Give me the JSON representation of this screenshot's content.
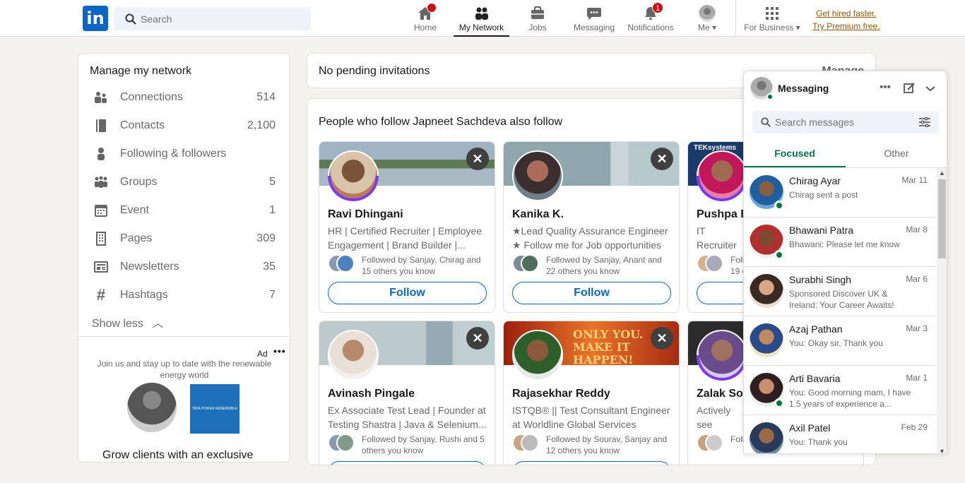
{
  "header": {
    "search_placeholder": "Search",
    "nav": [
      {
        "label": "Home",
        "icon": "home-icon"
      },
      {
        "label": "My Network",
        "icon": "network-icon"
      },
      {
        "label": "Jobs",
        "icon": "briefcase-icon"
      },
      {
        "label": "Messaging",
        "icon": "chat-icon"
      },
      {
        "label": "Notifications",
        "icon": "bell-icon",
        "badge": "1"
      },
      {
        "label": "Me",
        "icon": "avatar"
      },
      {
        "label": "For Business",
        "icon": "grid-icon"
      }
    ],
    "premium_line1": "Get hired faster.",
    "premium_line2": "Try Premium free."
  },
  "manage": {
    "title": "Manage my network",
    "items": [
      {
        "label": "Connections",
        "count": "514"
      },
      {
        "label": "Contacts",
        "count": "2,100"
      },
      {
        "label": "Following & followers",
        "count": ""
      },
      {
        "label": "Groups",
        "count": "5"
      },
      {
        "label": "Event",
        "count": "1"
      },
      {
        "label": "Pages",
        "count": "309"
      },
      {
        "label": "Newsletters",
        "count": "35"
      },
      {
        "label": "Hashtags",
        "count": "7"
      }
    ],
    "show_less": "Show less",
    "ad": {
      "label": "Ad",
      "text": "Join us and stay up to date with the renewable energy world",
      "logo_text": "TATA POWER RENEWABLE ENERGY",
      "more": "Grow clients with an exclusive"
    }
  },
  "invitations": {
    "text": "No pending invitations",
    "manage": "Manage"
  },
  "suggestions": {
    "title": "People who follow Japneet Sachdeva also follow",
    "follow_label": "Follow",
    "people": [
      {
        "name": "Ravi Dhingani",
        "desc": "HR | Certified Recruiter | Employee Engagement | Brand Builder |...",
        "followed": "Followed by Sanjay, Chirag and 15 others you know"
      },
      {
        "name": "Kanika K.",
        "desc": "★Lead Quality Assurance Engineer ★ Follow me for Job opportunities ...",
        "followed": "Followed by Sanjay, Anant and 22 others you know"
      },
      {
        "name": "Pushpa B",
        "desc": "IT Recruiter TEKsystems",
        "followed": "Foll 19 o",
        "cover_text": "TEKsystems"
      },
      {
        "name": "Avinash Pingale",
        "desc": "Ex Associate Test Lead | Founder at Testing Shastra | Java & Selenium...",
        "followed": "Followed by Sanjay, Rushi and 5 others you know"
      },
      {
        "name": "Rajasekhar Reddy",
        "desc": "ISTQB® || Test Consultant Engineer at Worldline Global Services",
        "followed": "Followed by Sourav, Sanjay and 12 others you know",
        "cover_text": "ONLY YOU. MAKE IT HAPPEN!"
      },
      {
        "name": "Zalak Sola",
        "desc": "Actively see Interns, Gra",
        "followed": "Follo"
      }
    ]
  },
  "messaging": {
    "title": "Messaging",
    "search_placeholder": "Search messages",
    "tabs": [
      "Focused",
      "Other"
    ],
    "conversations": [
      {
        "name": "Chirag Ayar",
        "date": "Mar 11",
        "preview": "Chirag sent a post"
      },
      {
        "name": "Bhawani Patra",
        "date": "Mar 8",
        "preview": "Bhawani: Please let me know"
      },
      {
        "name": "Surabhi Singh",
        "date": "Mar 6",
        "preview": "Sponsored  Discover UK & Ireland: Your Career Awaits!"
      },
      {
        "name": "Azaj Pathan",
        "date": "Mar 3",
        "preview": "You: Okay sir, Thank you"
      },
      {
        "name": "Arti Bavaria",
        "date": "Mar 1",
        "preview": "You: Good morning mam, I have 1.5 years of experience a..."
      },
      {
        "name": "Axil Patel",
        "date": "Feb 29",
        "preview": "You: Thank you"
      }
    ]
  },
  "colors": {
    "brand": "#0a66c2",
    "badge": "#cc1016",
    "premium": "#915907",
    "online": "#057642",
    "focused_tab": "#01754f"
  }
}
